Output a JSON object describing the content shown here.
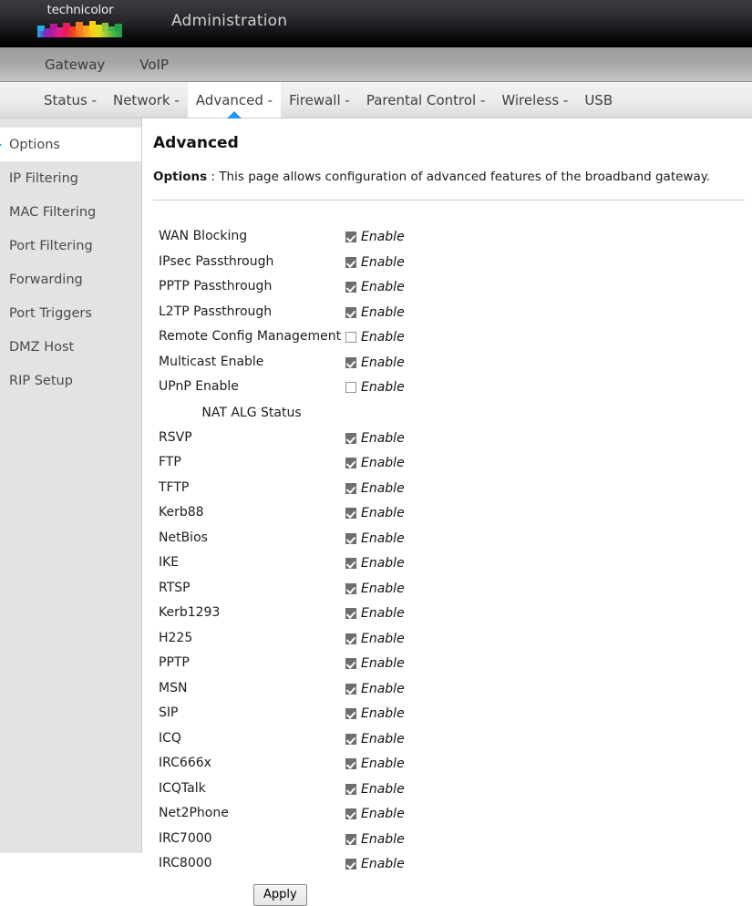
{
  "brand": {
    "logo_text": "technicolor",
    "logo_colors": [
      "#1cb3e8",
      "#7b2fbe",
      "#b3199b",
      "#e01e8a",
      "#e5195c",
      "#ef3d24",
      "#f47b20",
      "#f9a51a",
      "#fcd116",
      "#d7df23",
      "#8dc63f",
      "#3cb44b",
      "#22a04a"
    ],
    "app_title": "Administration"
  },
  "subnav": {
    "items": [
      {
        "label": "Gateway"
      },
      {
        "label": "VoIP"
      }
    ]
  },
  "tabs": [
    {
      "label": "Status -",
      "active": false
    },
    {
      "label": "Network -",
      "active": false
    },
    {
      "label": "Advanced -",
      "active": true
    },
    {
      "label": "Firewall -",
      "active": false
    },
    {
      "label": "Parental Control -",
      "active": false
    },
    {
      "label": "Wireless -",
      "active": false
    },
    {
      "label": "USB",
      "active": false
    }
  ],
  "sidebar": {
    "items": [
      {
        "label": "Options",
        "active": true
      },
      {
        "label": "IP Filtering",
        "active": false
      },
      {
        "label": "MAC Filtering",
        "active": false
      },
      {
        "label": "Port Filtering",
        "active": false
      },
      {
        "label": "Forwarding",
        "active": false
      },
      {
        "label": "Port Triggers",
        "active": false
      },
      {
        "label": "DMZ Host",
        "active": false
      },
      {
        "label": "RIP Setup",
        "active": false
      }
    ]
  },
  "main": {
    "page_title": "Advanced",
    "desc_label": "Options",
    "desc_sep": ":",
    "desc_text": "This page allows configuration of advanced features of the broadband gateway.",
    "enable_label": "Enable",
    "nat_section_title": "NAT ALG Status",
    "apply_label": "Apply",
    "options": [
      {
        "label": "WAN Blocking",
        "checked": true
      },
      {
        "label": "IPsec Passthrough",
        "checked": true
      },
      {
        "label": "PPTP Passthrough",
        "checked": true
      },
      {
        "label": "L2TP Passthrough",
        "checked": true
      },
      {
        "label": "Remote Config Management",
        "checked": false
      },
      {
        "label": "Multicast Enable",
        "checked": true
      },
      {
        "label": "UPnP Enable",
        "checked": false
      }
    ],
    "nat_options": [
      {
        "label": "RSVP",
        "checked": true
      },
      {
        "label": "FTP",
        "checked": true
      },
      {
        "label": "TFTP",
        "checked": true
      },
      {
        "label": "Kerb88",
        "checked": true
      },
      {
        "label": "NetBios",
        "checked": true
      },
      {
        "label": "IKE",
        "checked": true
      },
      {
        "label": "RTSP",
        "checked": true
      },
      {
        "label": "Kerb1293",
        "checked": true
      },
      {
        "label": "H225",
        "checked": true
      },
      {
        "label": "PPTP",
        "checked": true
      },
      {
        "label": "MSN",
        "checked": true
      },
      {
        "label": "SIP",
        "checked": true
      },
      {
        "label": "ICQ",
        "checked": true
      },
      {
        "label": "IRC666x",
        "checked": true
      },
      {
        "label": "ICQTalk",
        "checked": true
      },
      {
        "label": "Net2Phone",
        "checked": true
      },
      {
        "label": "IRC7000",
        "checked": true
      },
      {
        "label": "IRC8000",
        "checked": true
      }
    ]
  },
  "colors": {
    "accent": "#2196f3",
    "sidebar_bg": "#e3e3e3",
    "checkbox_on": "#6e6e6e"
  }
}
